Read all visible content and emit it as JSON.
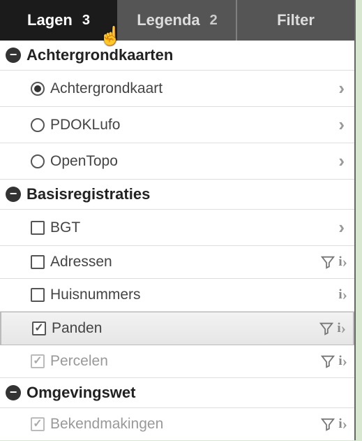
{
  "tabs": {
    "lagen": {
      "label": "Lagen",
      "badge": "3"
    },
    "legenda": {
      "label": "Legenda",
      "badge": "2"
    },
    "filter": {
      "label": "Filter"
    }
  },
  "groups": {
    "achtergrond": {
      "title": "Achtergrondkaarten"
    },
    "basis": {
      "title": "Basisregistraties"
    },
    "omgeving": {
      "title": "Omgevingswet"
    }
  },
  "items": {
    "achtergrondkaart": "Achtergrondkaart",
    "pdoklufo": "PDOKLufo",
    "opentopo": "OpenTopo",
    "bgt": "BGT",
    "adressen": "Adressen",
    "huisnummers": "Huisnummers",
    "panden": "Panden",
    "percelen": "Percelen",
    "bekendmakingen": "Bekendmakingen"
  }
}
